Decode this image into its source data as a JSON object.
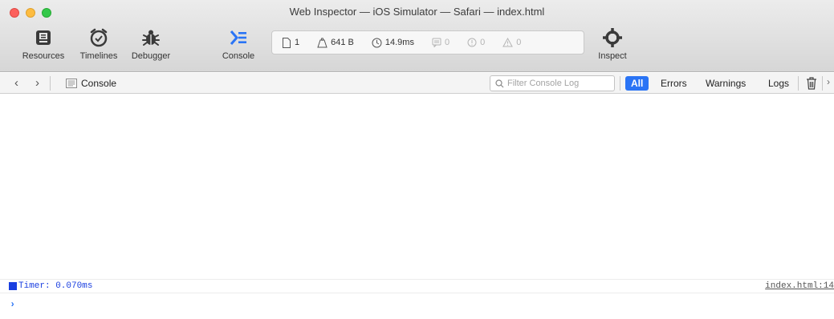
{
  "window": {
    "title": "Web Inspector — iOS Simulator — Safari — index.html"
  },
  "toolbar": {
    "resources_label": "Resources",
    "timelines_label": "Timelines",
    "debugger_label": "Debugger",
    "console_label": "Console",
    "inspect_label": "Inspect",
    "accent_color": "#2a74f5"
  },
  "dashboard": {
    "resource_count": "1",
    "resource_size": "641 B",
    "load_time": "14.9ms",
    "log_count": "0",
    "error_count": "0",
    "warning_count": "0"
  },
  "navbar": {
    "breadcrumb_label": "Console",
    "filter_placeholder": "Filter Console Log",
    "scopes": [
      "All",
      "Errors",
      "Warnings",
      "Logs"
    ],
    "active_scope": "All"
  },
  "console": {
    "messages": [
      {
        "text": "Timer: 0.070ms",
        "source": "index.html:14",
        "color": "#1a3fe0"
      }
    ],
    "prompt_glyph": "›"
  }
}
